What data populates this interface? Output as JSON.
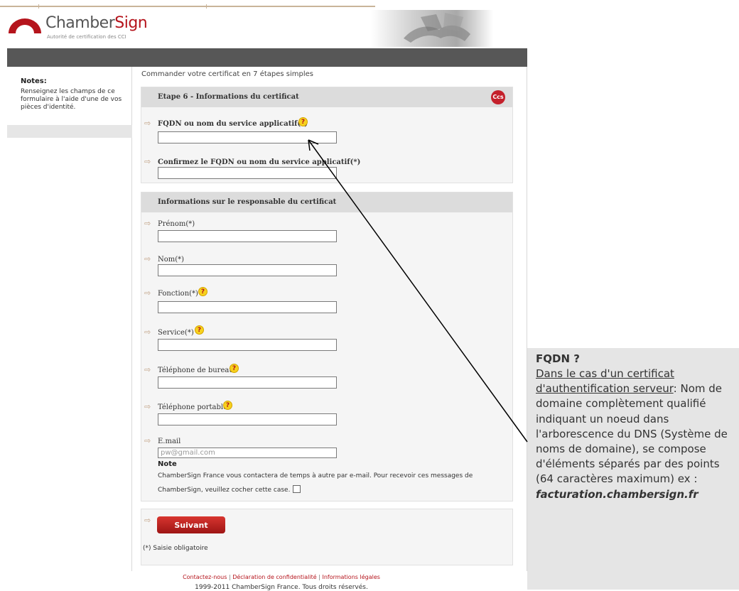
{
  "brand": {
    "name_part1": "Chamber",
    "name_part2": "Sign",
    "subtitle": "Autorité de certification des CCI",
    "primary_color": "#b5141c"
  },
  "sidebar": {
    "notes_title": "Notes:",
    "notes_text": "Renseignez les champs de ce formulaire à l'aide d'une de vos pièces d'identité."
  },
  "main": {
    "heading": "Commander votre certificat en 7 étapes simples"
  },
  "step_panel": {
    "title": "Etape 6 - Informations du certificat",
    "badge": "Ccs",
    "fqdn_label": "FQDN ou nom du service applicatif(*)",
    "fqdn_value": "",
    "confirm_label": "Confirmez le FQDN ou nom du service applicatif(*)",
    "confirm_value": ""
  },
  "responsable_panel": {
    "title": "Informations sur le responsable du certificat",
    "fields": [
      {
        "label": "Prénom(*)",
        "value": ""
      },
      {
        "label": "Nom(*)",
        "value": ""
      },
      {
        "label": "Fonction(*)",
        "value": ""
      },
      {
        "label": "Service(*)",
        "value": ""
      },
      {
        "label": "Téléphone de bureau",
        "value": ""
      },
      {
        "label": "Téléphone portable",
        "value": ""
      },
      {
        "label": "E.mail",
        "value": "",
        "placeholder": "pw@gmail.com"
      }
    ],
    "note_title": "Note",
    "note_text": "ChamberSign France vous contactera de temps à autre par e-mail. Pour recevoir ces messages de ChamberSign, veuillez cocher cette case."
  },
  "actions": {
    "next_label": "Suivant",
    "mandatory_text": "(*) Saisie obligatoire"
  },
  "footer": {
    "links": [
      "Contactez-nous",
      "Déclaration de confidentialité",
      "Informations légales"
    ],
    "separator": "|",
    "copyright": "1999-2011 ChamberSign France. Tous droits réservés."
  },
  "callout": {
    "title": "FQDN ?",
    "underlined_text": "Dans le cas d'un certificat d'authentification serveur",
    "underlined_suffix": ":",
    "body": "Nom de domaine complètement qualifié indiquant un noeud dans l'arborescence du DNS (Système de noms de domaine), se compose d'éléments séparés par des points (64 caractères maximum) ex :",
    "example": "facturation.chambersign.fr"
  }
}
